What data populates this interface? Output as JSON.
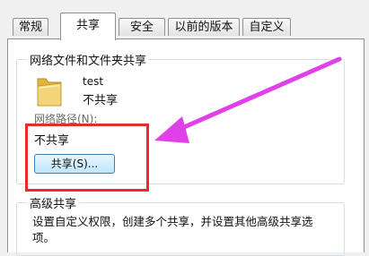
{
  "tabs": [
    "常规",
    "共享",
    "安全",
    "以前的版本",
    "自定义"
  ],
  "sections": {
    "network_title": "网络文件和文件夹共享",
    "folder_name": "test",
    "folder_status": "不共享",
    "path_label": "网络路径(N):",
    "path_value": "不共享",
    "share_button": "共享(S)...",
    "advanced_title": "高级共享",
    "advanced_desc_line1": "设置自定义权限，创建多个共享，并设置其他高级共享选",
    "advanced_desc_line2": "项。"
  },
  "colors": {
    "highlight": "#e8292e",
    "arrow": "#e040e8",
    "button_border": "#3c7fb1"
  }
}
